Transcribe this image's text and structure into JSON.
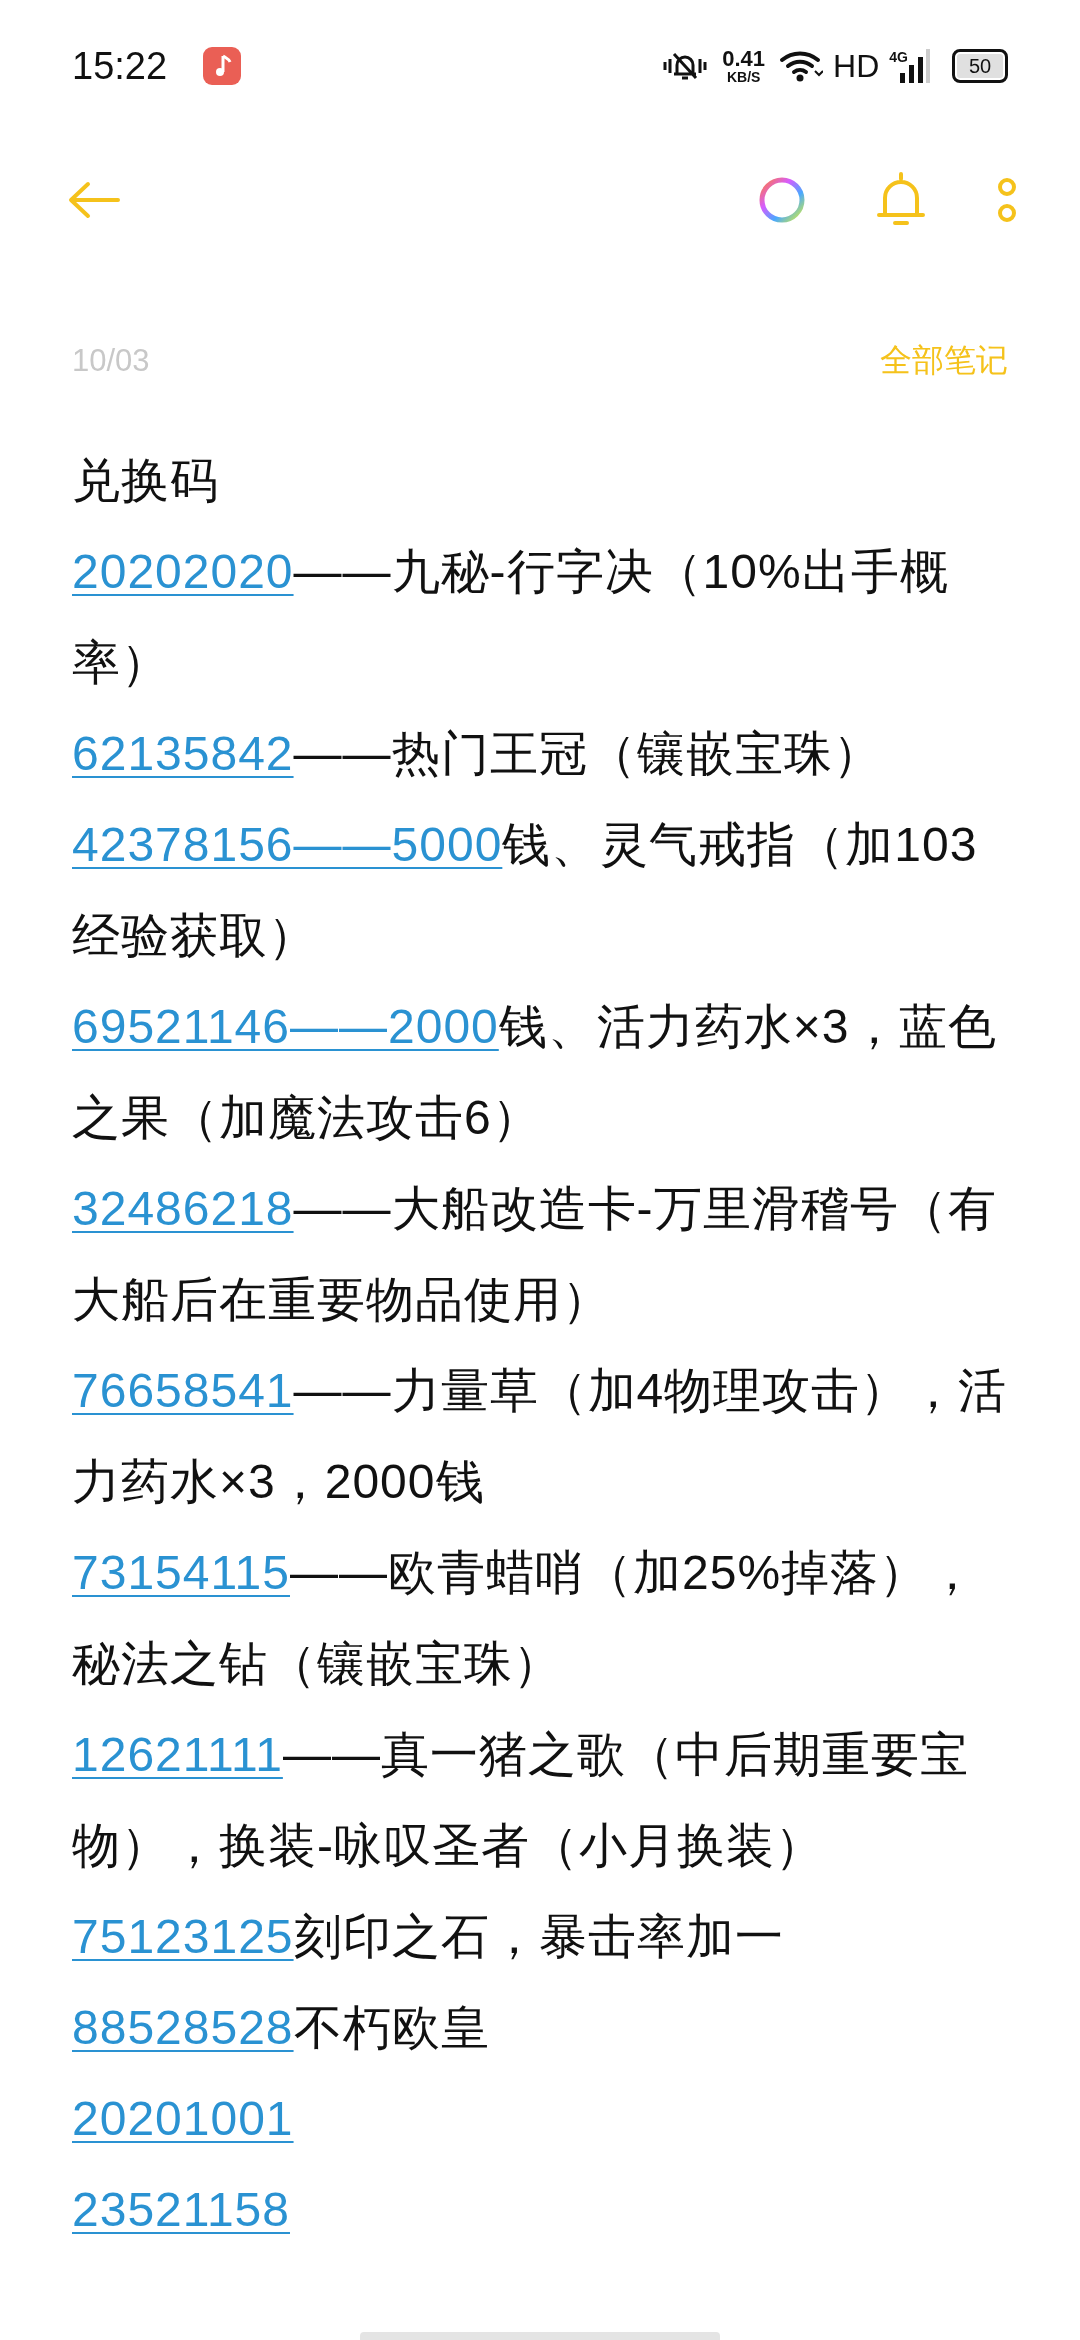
{
  "status_bar": {
    "time": "15:22",
    "net_speed": "0.41",
    "net_unit": "KB/S",
    "hd": "HD",
    "network": "4G",
    "battery": "50"
  },
  "note": {
    "date": "10/03",
    "all_notes_link": "全部笔记",
    "title": "兑换码",
    "entries": [
      {
        "code": "20202020",
        "text": "——九秘-行字决（10%出手概率）"
      },
      {
        "code": "62135842",
        "text": "——热门王冠（镶嵌宝珠）"
      },
      {
        "code": "42378156——5000",
        "text": "钱、灵气戒指（加103经验获取）"
      },
      {
        "code": "69521146——2000",
        "text": "钱、活力药水×3，蓝色之果（加魔法攻击6）"
      },
      {
        "code": "32486218",
        "text": "——大船改造卡-万里滑稽号（有大船后在重要物品使用）"
      },
      {
        "code": "76658541",
        "text": "——力量草（加4物理攻击），活力药水×3，2000钱"
      },
      {
        "code": "73154115",
        "text": "——欧青蜡哨（加25%掉落），秘法之钻（镶嵌宝珠）"
      },
      {
        "code": "12621111",
        "text": "——真一猪之歌（中后期重要宝物），换装-咏叹圣者（小月换装）"
      },
      {
        "code": "75123125",
        "text": "刻印之石，暴击率加一"
      },
      {
        "code": "88528528",
        "text": "不朽欧皇"
      },
      {
        "code": "20201001"
      },
      {
        "code": "23521158"
      }
    ]
  }
}
